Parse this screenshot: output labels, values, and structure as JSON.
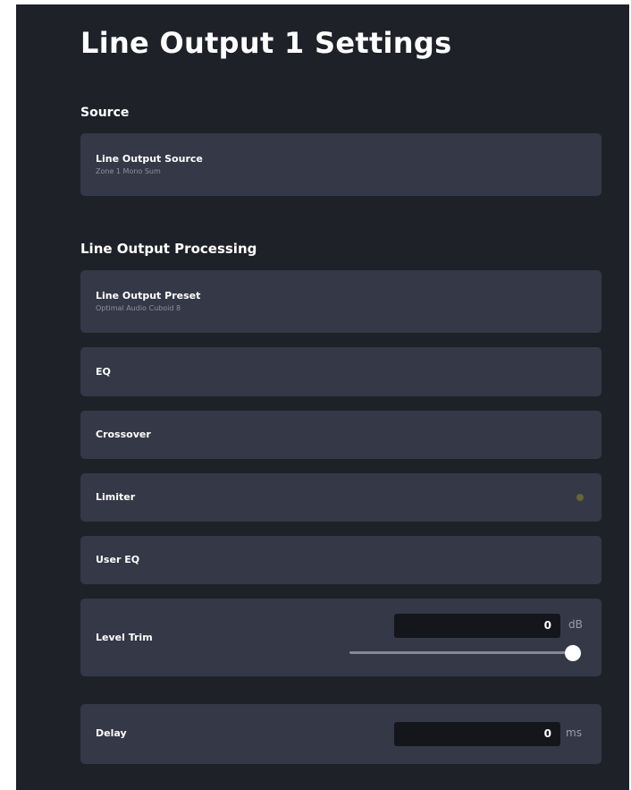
{
  "page": {
    "title": "Line Output 1 Settings"
  },
  "source": {
    "heading": "Source",
    "line_output_source": {
      "label": "Line Output Source",
      "value": "Zone 1 Mono Sum"
    }
  },
  "processing": {
    "heading": "Line Output Processing",
    "preset": {
      "label": "Line Output Preset",
      "value": "Optimal Audio Cuboid 8"
    },
    "eq": {
      "label": "EQ"
    },
    "crossover": {
      "label": "Crossover"
    },
    "limiter": {
      "label": "Limiter",
      "indicator_color": "#676537"
    },
    "user_eq": {
      "label": "User EQ"
    },
    "level_trim": {
      "label": "Level Trim",
      "value": "0",
      "unit": "dB",
      "slider_fraction": 1.0
    },
    "delay": {
      "label": "Delay",
      "value": "0",
      "unit": "ms"
    }
  },
  "colors": {
    "background": "#1f2129",
    "card": "#353846",
    "input": "#14161c",
    "text": "#ffffff",
    "subtext": "#8d91a3"
  }
}
